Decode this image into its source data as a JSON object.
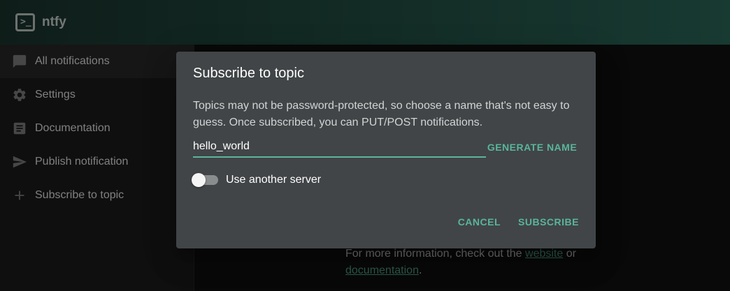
{
  "app": {
    "title": "ntfy",
    "logo_glyph": ">_"
  },
  "sidebar": {
    "items": [
      {
        "label": "All notifications",
        "icon": "chat-bubble-icon",
        "active": true
      },
      {
        "label": "Settings",
        "icon": "gear-icon",
        "active": false
      },
      {
        "label": "Documentation",
        "icon": "article-icon",
        "active": false
      },
      {
        "label": "Publish notification",
        "icon": "send-icon",
        "active": false
      },
      {
        "label": "Subscribe to topic",
        "icon": "plus-icon",
        "active": false
      }
    ]
  },
  "main": {
    "info_prefix": "For more information, check out the",
    "info_link1": "website",
    "info_mid": "or",
    "info_link2": "documentation",
    "info_suffix": "."
  },
  "dialog": {
    "title": "Subscribe to topic",
    "description": "Topics may not be password-protected, so choose a name that's not easy to guess. Once subscribed, you can PUT/POST notifications.",
    "topic_value": "hello_world",
    "generate_label": "GENERATE NAME",
    "switch_label": "Use another server",
    "switch_on": false,
    "cancel_label": "CANCEL",
    "subscribe_label": "SUBSCRIBE"
  },
  "colors": {
    "accent": "#5ab59a",
    "dialog_bg": "#414547",
    "appbar_start": "#1e3a33",
    "appbar_end": "#2f7463"
  }
}
